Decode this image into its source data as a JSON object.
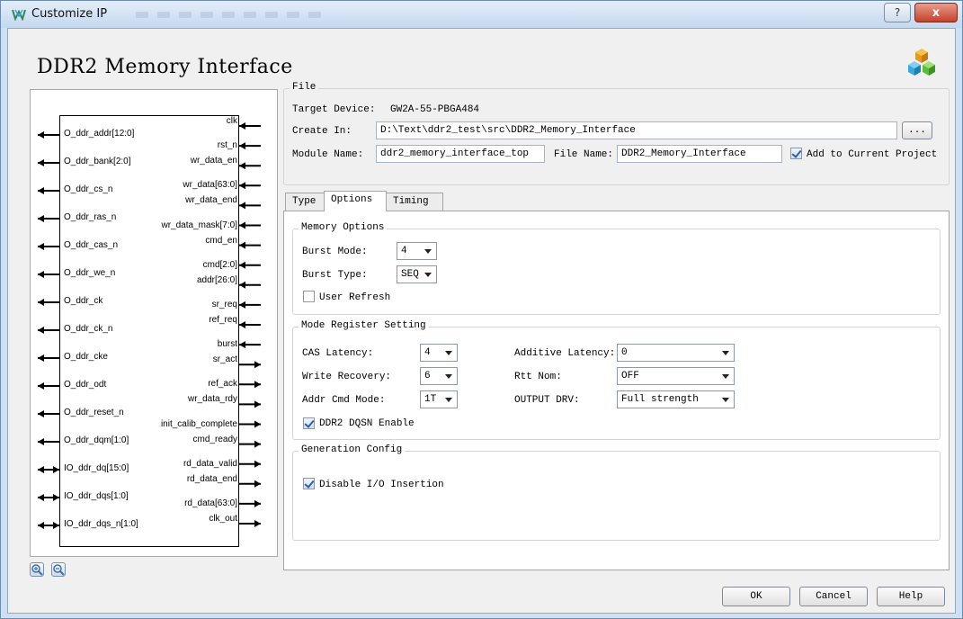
{
  "window": {
    "title": "Customize IP",
    "help_label": "?",
    "close_label": "x"
  },
  "page_title": "DDR2 Memory Interface",
  "diagram": {
    "left_ports": [
      {
        "name": "O_ddr_addr[12:0]",
        "dir": "out"
      },
      {
        "name": "O_ddr_bank[2:0]",
        "dir": "out"
      },
      {
        "name": "O_ddr_cs_n",
        "dir": "out"
      },
      {
        "name": "O_ddr_ras_n",
        "dir": "out"
      },
      {
        "name": "O_ddr_cas_n",
        "dir": "out"
      },
      {
        "name": "O_ddr_we_n",
        "dir": "out"
      },
      {
        "name": "O_ddr_ck",
        "dir": "out"
      },
      {
        "name": "O_ddr_ck_n",
        "dir": "out"
      },
      {
        "name": "O_ddr_cke",
        "dir": "out"
      },
      {
        "name": "O_ddr_odt",
        "dir": "out"
      },
      {
        "name": "O_ddr_reset_n",
        "dir": "out"
      },
      {
        "name": "O_ddr_dqm[1:0]",
        "dir": "out"
      },
      {
        "name": "IO_ddr_dq[15:0]",
        "dir": "inout"
      },
      {
        "name": "IO_ddr_dqs[1:0]",
        "dir": "inout"
      },
      {
        "name": "IO_ddr_dqs_n[1:0]",
        "dir": "inout"
      }
    ],
    "right_ports": [
      {
        "name": "clk",
        "dir": "in"
      },
      {
        "name": "rst_n",
        "dir": "in"
      },
      {
        "name": "wr_data_en",
        "dir": "in"
      },
      {
        "name": "wr_data[63:0]",
        "dir": "in"
      },
      {
        "name": "wr_data_end",
        "dir": "in"
      },
      {
        "name": "wr_data_mask[7:0]",
        "dir": "in"
      },
      {
        "name": "cmd_en",
        "dir": "in"
      },
      {
        "name": "cmd[2:0]",
        "dir": "in"
      },
      {
        "name": "addr[26:0]",
        "dir": "in"
      },
      {
        "name": "sr_req",
        "dir": "in"
      },
      {
        "name": "ref_req",
        "dir": "in"
      },
      {
        "name": "burst",
        "dir": "in"
      },
      {
        "name": "sr_act",
        "dir": "out"
      },
      {
        "name": "ref_ack",
        "dir": "out"
      },
      {
        "name": "wr_data_rdy",
        "dir": "out"
      },
      {
        "name": "init_calib_complete",
        "dir": "out"
      },
      {
        "name": "cmd_ready",
        "dir": "out"
      },
      {
        "name": "rd_data_valid",
        "dir": "out"
      },
      {
        "name": "rd_data_end",
        "dir": "out"
      },
      {
        "name": "rd_data[63:0]",
        "dir": "out"
      },
      {
        "name": "clk_out",
        "dir": "out"
      }
    ]
  },
  "file": {
    "group_title": "File",
    "target_device_label": "Target Device:",
    "target_device_value": "GW2A-55-PBGA484",
    "create_in_label": "Create In:",
    "create_in_value": "D:\\Text\\ddr2_test\\src\\DDR2_Memory_Interface",
    "browse_label": "...",
    "module_name_label": "Module Name:",
    "module_name_value": "ddr2_memory_interface_top",
    "file_name_label": "File Name:",
    "file_name_value": "DDR2_Memory_Interface",
    "add_to_project_label": "Add to Current Project",
    "add_to_project_checked": true
  },
  "tabs": [
    "Type",
    "Options",
    "Timing"
  ],
  "active_tab": "Options",
  "memory_options": {
    "group_title": "Memory Options",
    "burst_mode_label": "Burst Mode:",
    "burst_mode_value": "4",
    "burst_type_label": "Burst Type:",
    "burst_type_value": "SEQ",
    "user_refresh_label": "User Refresh",
    "user_refresh_checked": false
  },
  "mode_register": {
    "group_title": "Mode Register Setting",
    "cas_latency_label": "CAS Latency:",
    "cas_latency_value": "4",
    "write_recovery_label": "Write Recovery:",
    "write_recovery_value": "6",
    "addr_cmd_mode_label": "Addr Cmd Mode:",
    "addr_cmd_mode_value": "1T",
    "additive_latency_label": "Additive Latency:",
    "additive_latency_value": "0",
    "rtt_nom_label": "Rtt Nom:",
    "rtt_nom_value": "OFF",
    "output_drv_label": "OUTPUT DRV:",
    "output_drv_value": "Full strength",
    "dqsn_enable_label": "DDR2 DQSN Enable",
    "dqsn_enable_checked": true
  },
  "generation_config": {
    "group_title": "Generation Config",
    "disable_io_label": "Disable I/O Insertion",
    "disable_io_checked": true
  },
  "footer": {
    "ok_label": "OK",
    "cancel_label": "Cancel",
    "help_label": "Help"
  },
  "colors": {
    "window_frame": "#cfe0f2",
    "dialog_bg": "#f0f0f0",
    "close_button": "#c3412a",
    "check_mark": "#2f5fa8"
  }
}
